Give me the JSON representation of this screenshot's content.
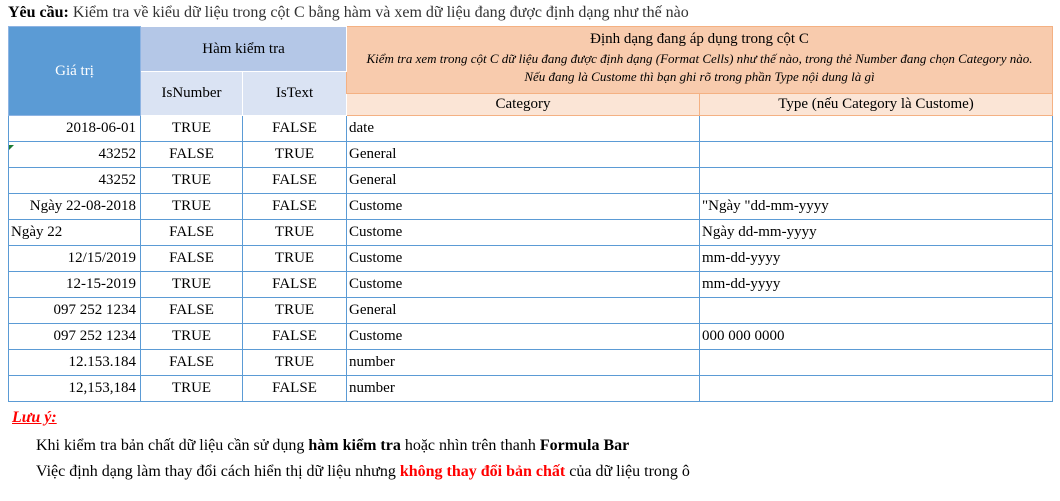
{
  "requirement": {
    "label": "Yêu cầu:",
    "text": " Kiểm tra về kiểu dữ liệu trong cột C bằng hàm và xem dữ liệu đang được định dạng như thế nào"
  },
  "headers": {
    "gia_tri": "Giá trị",
    "ham_kiem_tra": "Hàm kiểm tra",
    "is_number": "IsNumber",
    "is_text": "IsText",
    "dinh_dang_title": "Định dạng đang áp dụng trong cột C",
    "dinh_dang_desc": "Kiểm tra xem trong cột C dữ liệu đang được định dạng (Format Cells) như thế nào, trong thẻ Number đang chọn Category nào. Nếu đang là Custome thì bạn ghi rõ trong phần Type nội dung là gì",
    "category": "Category",
    "type": "Type (nếu Category là Custome)"
  },
  "rows": [
    {
      "value": "2018-06-01",
      "is_number": "TRUE",
      "is_text": "FALSE",
      "category": "date",
      "type": "",
      "align": "r"
    },
    {
      "value": "43252",
      "is_number": "FALSE",
      "is_text": "TRUE",
      "category": "General",
      "type": "",
      "align": "r"
    },
    {
      "value": "43252",
      "is_number": "TRUE",
      "is_text": "FALSE",
      "category": "General",
      "type": "",
      "align": "r"
    },
    {
      "value": "Ngày 22-08-2018",
      "is_number": "TRUE",
      "is_text": "FALSE",
      "category": "Custome",
      "type": "\"Ngày \"dd-mm-yyyy",
      "align": "r"
    },
    {
      "value": "Ngày 22",
      "is_number": "FALSE",
      "is_text": "TRUE",
      "category": "Custome",
      "type": "Ngày dd-mm-yyyy",
      "align": "l"
    },
    {
      "value": "12/15/2019",
      "is_number": "FALSE",
      "is_text": "TRUE",
      "category": "Custome",
      "type": "mm-dd-yyyy",
      "align": "r"
    },
    {
      "value": "12-15-2019",
      "is_number": "TRUE",
      "is_text": "FALSE",
      "category": "Custome",
      "type": "mm-dd-yyyy",
      "align": "r"
    },
    {
      "value": "097 252 1234",
      "is_number": "FALSE",
      "is_text": "TRUE",
      "category": "General",
      "type": "",
      "align": "r"
    },
    {
      "value": "097 252 1234",
      "is_number": "TRUE",
      "is_text": "FALSE",
      "category": "Custome",
      "type": "000 000 0000",
      "align": "r"
    },
    {
      "value": "12.153.184",
      "is_number": "FALSE",
      "is_text": "TRUE",
      "category": "number",
      "type": "",
      "align": "r"
    },
    {
      "value": "12,153,184",
      "is_number": "TRUE",
      "is_text": "FALSE",
      "category": "number",
      "type": "",
      "align": "r"
    }
  ],
  "note": {
    "title": "Lưu ý:",
    "line1_pre": "Khi kiểm tra bản chất dữ liệu cần sử dụng ",
    "line1_bold1": "hàm kiểm tra",
    "line1_mid": " hoặc nhìn trên thanh ",
    "line1_bold2": "Formula Bar",
    "line2_pre": "Việc định dạng làm thay đổi cách hiển thị dữ liệu nhưng ",
    "line2_red": "không thay đổi bản chất",
    "line2_post": " của dữ liệu trong ô"
  }
}
